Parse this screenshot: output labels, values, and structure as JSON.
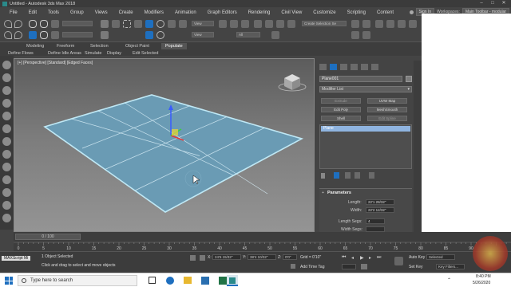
{
  "window": {
    "title": "Untitled - Autodesk 3ds Max 2018"
  },
  "menu": {
    "items": [
      "File",
      "Edit",
      "Tools",
      "Group",
      "Views",
      "Create",
      "Modifiers",
      "Animation",
      "Graph Editors",
      "Rendering",
      "Civil View",
      "Customize",
      "Scripting",
      "Content"
    ],
    "sign_in": "Sign In",
    "workspaces_label": "Workspaces:",
    "workspace_value": "Main Toolbar - modular"
  },
  "toolbar": {
    "view_select": "View",
    "filter_select": "All",
    "selection_set": "Create Selection Se"
  },
  "ribbon": {
    "tabs": [
      "Modeling",
      "Freeform",
      "Selection",
      "Object Paint",
      "Populate"
    ],
    "active_tab": "Populate",
    "subtabs": [
      "Define Flows",
      "Define Idle Areas",
      "Simulate",
      "Display",
      "Edit Selected"
    ]
  },
  "viewport": {
    "label": "[+] [Perspective] [Standard] [Edged Faces]"
  },
  "command_panel": {
    "object_name": "Plane001",
    "modifier_list": "Modifier List",
    "buttons": [
      "Extrude",
      "UVW Map",
      "Edit Poly",
      "MeshSmooth",
      "Shell",
      "Edit Spline"
    ],
    "stack_item": "Plane",
    "rollout_title": "Parameters",
    "length_label": "Length:",
    "length_value": "22'1 28/32\"",
    "width_label": "Width:",
    "width_value": "22'2 12/32\"",
    "length_segs_label": "Length Segs:",
    "length_segs_value": "4",
    "width_segs_label": "Width Segs:"
  },
  "timeline": {
    "frame_display": "0 / 100",
    "ticks": [
      "0",
      "5",
      "10",
      "15",
      "20",
      "25",
      "30",
      "35",
      "40",
      "45",
      "50",
      "55",
      "60",
      "65",
      "70",
      "75",
      "80",
      "85",
      "90"
    ]
  },
  "status": {
    "maxscript": "MAXScript Mi",
    "selected": "1 Object Selected",
    "prompt": "Click and drag to select and move objects",
    "x_label": "X:",
    "x_value": "24'6 15/32\"",
    "y_label": "Y:",
    "y_value": "38'4 10/32\"",
    "z_label": "Z:",
    "z_value": "0'0\"",
    "grid": "Grid = 0'10\"",
    "add_time_tag": "Add Time Tag",
    "auto_key": "Auto Key",
    "set_key": "Set Key",
    "selected_dropdown": "Selected",
    "key_filters": "Key Filters..."
  },
  "taskbar": {
    "search_placeholder": "Type here to search",
    "time": "8:40 PM",
    "date": "5/26/2020"
  },
  "colors": {
    "plane_fill": "#6a9bb4",
    "wire_highlight": "#bfe8f5",
    "ui_bg": "#444444",
    "accent_blue": "#1e6fbf"
  }
}
